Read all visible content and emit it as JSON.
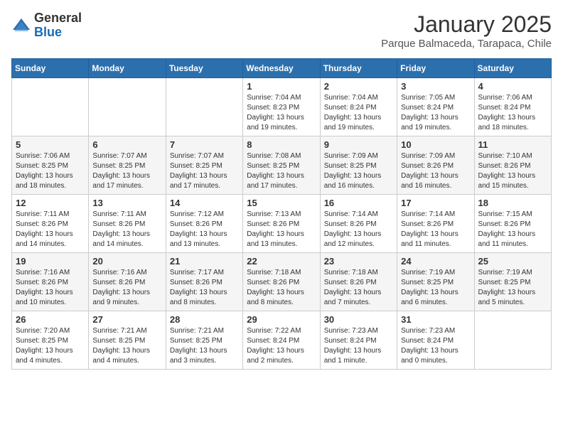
{
  "logo": {
    "general": "General",
    "blue": "Blue"
  },
  "header": {
    "month": "January 2025",
    "location": "Parque Balmaceda, Tarapaca, Chile"
  },
  "weekdays": [
    "Sunday",
    "Monday",
    "Tuesday",
    "Wednesday",
    "Thursday",
    "Friday",
    "Saturday"
  ],
  "weeks": [
    [
      {
        "day": "",
        "info": ""
      },
      {
        "day": "",
        "info": ""
      },
      {
        "day": "",
        "info": ""
      },
      {
        "day": "1",
        "info": "Sunrise: 7:04 AM\nSunset: 8:23 PM\nDaylight: 13 hours and 19 minutes."
      },
      {
        "day": "2",
        "info": "Sunrise: 7:04 AM\nSunset: 8:24 PM\nDaylight: 13 hours and 19 minutes."
      },
      {
        "day": "3",
        "info": "Sunrise: 7:05 AM\nSunset: 8:24 PM\nDaylight: 13 hours and 19 minutes."
      },
      {
        "day": "4",
        "info": "Sunrise: 7:06 AM\nSunset: 8:24 PM\nDaylight: 13 hours and 18 minutes."
      }
    ],
    [
      {
        "day": "5",
        "info": "Sunrise: 7:06 AM\nSunset: 8:25 PM\nDaylight: 13 hours and 18 minutes."
      },
      {
        "day": "6",
        "info": "Sunrise: 7:07 AM\nSunset: 8:25 PM\nDaylight: 13 hours and 17 minutes."
      },
      {
        "day": "7",
        "info": "Sunrise: 7:07 AM\nSunset: 8:25 PM\nDaylight: 13 hours and 17 minutes."
      },
      {
        "day": "8",
        "info": "Sunrise: 7:08 AM\nSunset: 8:25 PM\nDaylight: 13 hours and 17 minutes."
      },
      {
        "day": "9",
        "info": "Sunrise: 7:09 AM\nSunset: 8:25 PM\nDaylight: 13 hours and 16 minutes."
      },
      {
        "day": "10",
        "info": "Sunrise: 7:09 AM\nSunset: 8:26 PM\nDaylight: 13 hours and 16 minutes."
      },
      {
        "day": "11",
        "info": "Sunrise: 7:10 AM\nSunset: 8:26 PM\nDaylight: 13 hours and 15 minutes."
      }
    ],
    [
      {
        "day": "12",
        "info": "Sunrise: 7:11 AM\nSunset: 8:26 PM\nDaylight: 13 hours and 14 minutes."
      },
      {
        "day": "13",
        "info": "Sunrise: 7:11 AM\nSunset: 8:26 PM\nDaylight: 13 hours and 14 minutes."
      },
      {
        "day": "14",
        "info": "Sunrise: 7:12 AM\nSunset: 8:26 PM\nDaylight: 13 hours and 13 minutes."
      },
      {
        "day": "15",
        "info": "Sunrise: 7:13 AM\nSunset: 8:26 PM\nDaylight: 13 hours and 13 minutes."
      },
      {
        "day": "16",
        "info": "Sunrise: 7:14 AM\nSunset: 8:26 PM\nDaylight: 13 hours and 12 minutes."
      },
      {
        "day": "17",
        "info": "Sunrise: 7:14 AM\nSunset: 8:26 PM\nDaylight: 13 hours and 11 minutes."
      },
      {
        "day": "18",
        "info": "Sunrise: 7:15 AM\nSunset: 8:26 PM\nDaylight: 13 hours and 11 minutes."
      }
    ],
    [
      {
        "day": "19",
        "info": "Sunrise: 7:16 AM\nSunset: 8:26 PM\nDaylight: 13 hours and 10 minutes."
      },
      {
        "day": "20",
        "info": "Sunrise: 7:16 AM\nSunset: 8:26 PM\nDaylight: 13 hours and 9 minutes."
      },
      {
        "day": "21",
        "info": "Sunrise: 7:17 AM\nSunset: 8:26 PM\nDaylight: 13 hours and 8 minutes."
      },
      {
        "day": "22",
        "info": "Sunrise: 7:18 AM\nSunset: 8:26 PM\nDaylight: 13 hours and 8 minutes."
      },
      {
        "day": "23",
        "info": "Sunrise: 7:18 AM\nSunset: 8:26 PM\nDaylight: 13 hours and 7 minutes."
      },
      {
        "day": "24",
        "info": "Sunrise: 7:19 AM\nSunset: 8:25 PM\nDaylight: 13 hours and 6 minutes."
      },
      {
        "day": "25",
        "info": "Sunrise: 7:19 AM\nSunset: 8:25 PM\nDaylight: 13 hours and 5 minutes."
      }
    ],
    [
      {
        "day": "26",
        "info": "Sunrise: 7:20 AM\nSunset: 8:25 PM\nDaylight: 13 hours and 4 minutes."
      },
      {
        "day": "27",
        "info": "Sunrise: 7:21 AM\nSunset: 8:25 PM\nDaylight: 13 hours and 4 minutes."
      },
      {
        "day": "28",
        "info": "Sunrise: 7:21 AM\nSunset: 8:25 PM\nDaylight: 13 hours and 3 minutes."
      },
      {
        "day": "29",
        "info": "Sunrise: 7:22 AM\nSunset: 8:24 PM\nDaylight: 13 hours and 2 minutes."
      },
      {
        "day": "30",
        "info": "Sunrise: 7:23 AM\nSunset: 8:24 PM\nDaylight: 13 hours and 1 minute."
      },
      {
        "day": "31",
        "info": "Sunrise: 7:23 AM\nSunset: 8:24 PM\nDaylight: 13 hours and 0 minutes."
      },
      {
        "day": "",
        "info": ""
      }
    ]
  ]
}
